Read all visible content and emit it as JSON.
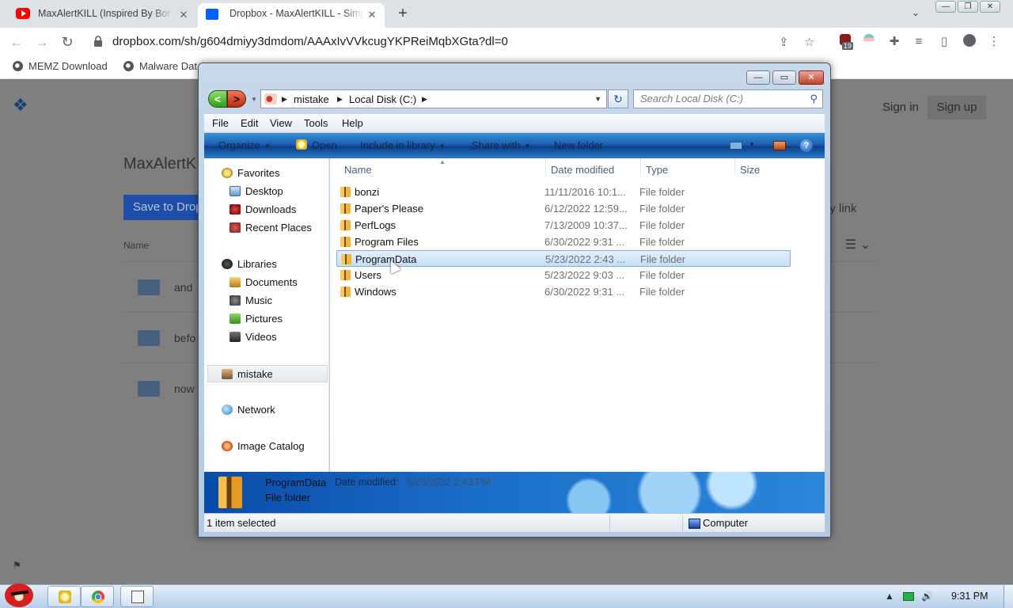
{
  "browser": {
    "tabs": [
      {
        "title": "MaxAlertKILL (Inspired By Bonzi",
        "active": false,
        "favicon": "youtube-icon"
      },
      {
        "title": "Dropbox - MaxAlertKILL - Simplify",
        "active": true,
        "favicon": "dropbox-icon"
      }
    ],
    "url": "dropbox.com/sh/g604dmiyy3dmdom/AAAxIvVVkcugYKPReiMqbXGta?dl=0",
    "extension_badge": "19",
    "bookmarks": [
      "MEMZ Download",
      "Malware Dat"
    ]
  },
  "dropbox": {
    "title": "MaxAlertK",
    "sign_in": "Sign in",
    "sign_up": "Sign up",
    "save_button": "Save to Drop",
    "copy_link": "py link",
    "col_name": "Name",
    "rows": [
      "and",
      "befo",
      "now"
    ]
  },
  "explorer": {
    "address": {
      "root": "mistake",
      "current": "Local Disk (C:)"
    },
    "search_placeholder": "Search Local Disk (C:)",
    "menu": [
      "File",
      "Edit",
      "View",
      "Tools",
      "Help"
    ],
    "commands": {
      "organize": "Organize",
      "open": "Open",
      "include": "Include in library",
      "share": "Share with",
      "new_folder": "New folder"
    },
    "nav": {
      "favorites": "Favorites",
      "desktop": "Desktop",
      "downloads": "Downloads",
      "recent": "Recent Places",
      "libraries": "Libraries",
      "documents": "Documents",
      "music": "Music",
      "pictures": "Pictures",
      "videos": "Videos",
      "home": "mistake",
      "network": "Network",
      "catalog": "Image Catalog"
    },
    "columns": {
      "name": "Name",
      "date": "Date modified",
      "type": "Type",
      "size": "Size"
    },
    "files": [
      {
        "name": "bonzi",
        "date": "11/11/2016 10:1...",
        "type": "File folder"
      },
      {
        "name": "Paper's Please",
        "date": "6/12/2022 12:59...",
        "type": "File folder"
      },
      {
        "name": "PerfLogs",
        "date": "7/13/2009 10:37...",
        "type": "File folder"
      },
      {
        "name": "Program Files",
        "date": "6/30/2022 9:31 ...",
        "type": "File folder"
      },
      {
        "name": "ProgramData",
        "date": "5/23/2022 2:43 ...",
        "type": "File folder"
      },
      {
        "name": "Users",
        "date": "5/23/2022 9:03 ...",
        "type": "File folder"
      },
      {
        "name": "Windows",
        "date": "6/30/2022 9:31 ...",
        "type": "File folder"
      }
    ],
    "details": {
      "name": "ProgramData",
      "label": "Date modified:",
      "value": "5/23/2022 2:43 PM",
      "type": "File folder"
    },
    "status": {
      "selected": "1 item selected",
      "location": "Computer"
    }
  },
  "taskbar": {
    "clock": "9:31 PM"
  }
}
